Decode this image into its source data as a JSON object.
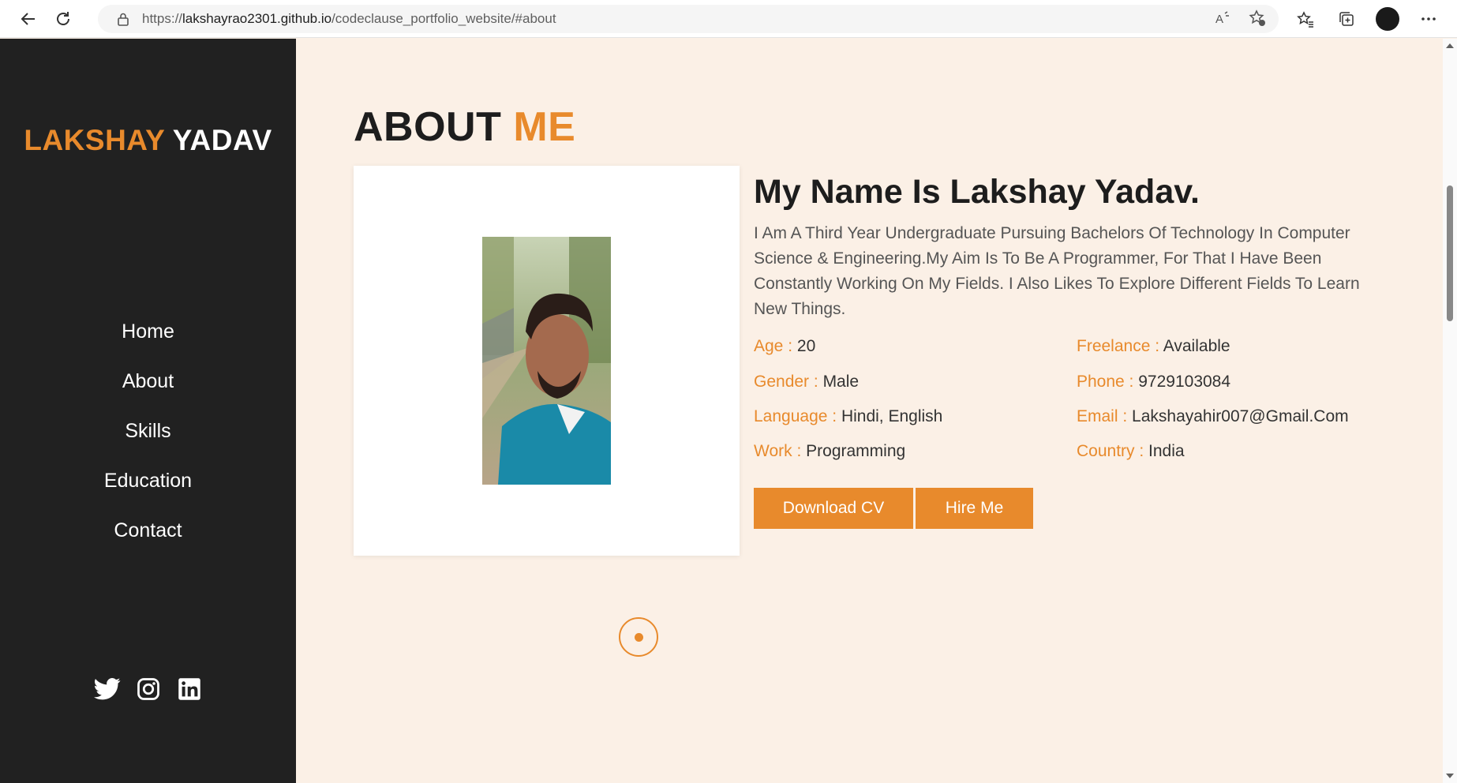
{
  "browser": {
    "url_prefix": "https://",
    "url_host": "lakshayrao2301.github.io",
    "url_path": "/codeclause_portfolio_website/#about",
    "icons": [
      "back-icon",
      "refresh-icon",
      "lock-icon",
      "read-aloud-icon",
      "add-favorite-icon",
      "favorites-icon",
      "collections-icon",
      "profile-avatar",
      "more-icon"
    ]
  },
  "sidebar": {
    "brand_first": "LAKSHAY",
    "brand_last": "YADAV",
    "menu": [
      "Home",
      "About",
      "Skills",
      "Education",
      "Contact"
    ],
    "socials": [
      "twitter-icon",
      "instagram-icon",
      "linkedin-icon"
    ]
  },
  "about": {
    "title_main": "ABOUT",
    "title_accent": "ME",
    "heading": "My Name Is Lakshay Yadav.",
    "description": "I Am A Third Year Undergraduate Pursuing Bachelors Of Technology In Computer Science & Engineering.My Aim Is To Be A Programmer, For That I Have Been Constantly Working On My Fields. I Also Likes To Explore Different Fields To Learn New Things.",
    "fields": [
      {
        "label": "Age :",
        "value": "20"
      },
      {
        "label": "Gender :",
        "value": "Male"
      },
      {
        "label": "Language :",
        "value": "Hindi, English"
      },
      {
        "label": "Work :",
        "value": "Programming"
      },
      {
        "label": "Freelance :",
        "value": "Available"
      },
      {
        "label": "Phone :",
        "value": "9729103084"
      },
      {
        "label": "Email :",
        "value": "Lakshayahir007@Gmail.Com"
      },
      {
        "label": "Country :",
        "value": "India"
      }
    ],
    "buttons": {
      "cv": "Download CV",
      "hire": "Hire Me"
    }
  },
  "colors": {
    "accent": "#e88a2c",
    "sidebar": "#212121",
    "background": "#fbf0e6"
  }
}
